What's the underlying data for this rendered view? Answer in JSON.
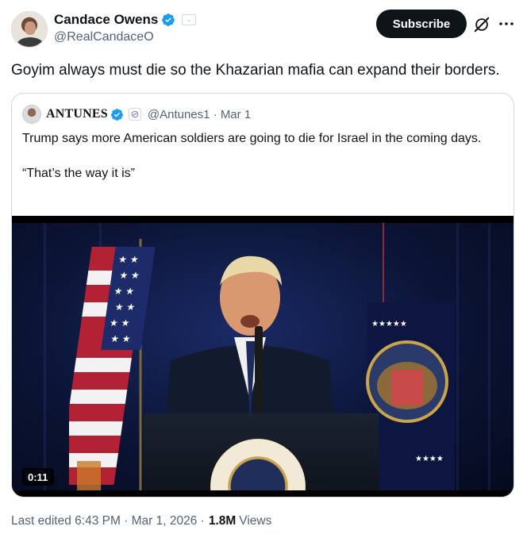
{
  "author": {
    "display_name": "Candace Owens",
    "handle": "@RealCandaceO",
    "verified": true
  },
  "actions": {
    "subscribe_label": "Subscribe"
  },
  "tweet": {
    "text": "Goyim always must die so the Khazarian mafia can expand their borders."
  },
  "quoted": {
    "display_name": "ANTUNES",
    "handle_date": "@Antunes1 · Mar 1",
    "line1": "Trump says more American soldiers are going to die for Israel in the coming days.",
    "line2": "“That’s the way it is”",
    "video_duration": "0:11"
  },
  "footer": {
    "edited": "Last edited 6:43 PM · Mar 1, 2026 ·",
    "views_count": "1.8M",
    "views_label": "Views"
  },
  "colors": {
    "verified_blue": "#1d9bf0",
    "text_primary": "#0f1419",
    "text_secondary": "#536471",
    "border": "#cfd9de"
  },
  "icons": [
    "verified-badge-icon",
    "affiliate-badge-icon",
    "grok-icon",
    "more-icon"
  ]
}
